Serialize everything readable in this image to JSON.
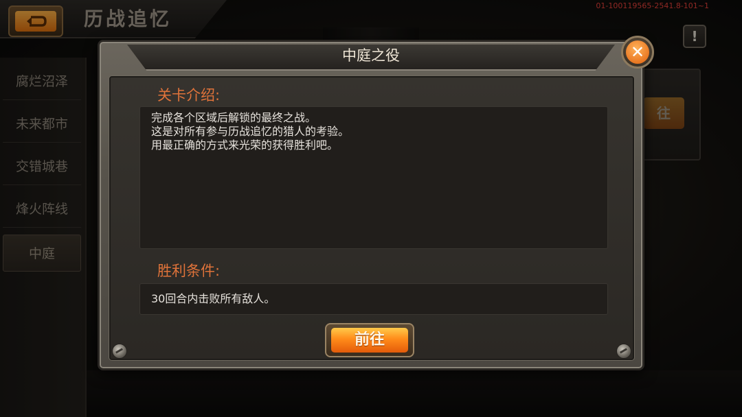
{
  "header": {
    "back_icon": "return-arrow-icon",
    "title": "历战追忆",
    "build_id": "01-100119565-2541.8-101~1",
    "alert_label": "!"
  },
  "sidebar": {
    "items": [
      {
        "label": "腐烂沼泽",
        "active": false
      },
      {
        "label": "未来都市",
        "active": false
      },
      {
        "label": "交错城巷",
        "active": false
      },
      {
        "label": "烽火阵线",
        "active": false
      },
      {
        "label": "中庭",
        "active": true
      }
    ]
  },
  "background_card": {
    "button_label": "往"
  },
  "dialog": {
    "title": "中庭之役",
    "close_icon": "close-x-icon",
    "intro_label": "关卡介绍:",
    "intro_lines": [
      "完成各个区域后解锁的最终之战。",
      "这是对所有参与历战追忆的猎人的考验。",
      "用最正确的方式来光荣的获得胜利吧。"
    ],
    "victory_label": "胜利条件:",
    "victory_text": "30回合内击败所有敌人。",
    "go_button_label": "前往"
  },
  "colors": {
    "accent_orange": "#ff8c1a",
    "section_label": "#e0733a",
    "build_id_red": "#e8413a"
  }
}
